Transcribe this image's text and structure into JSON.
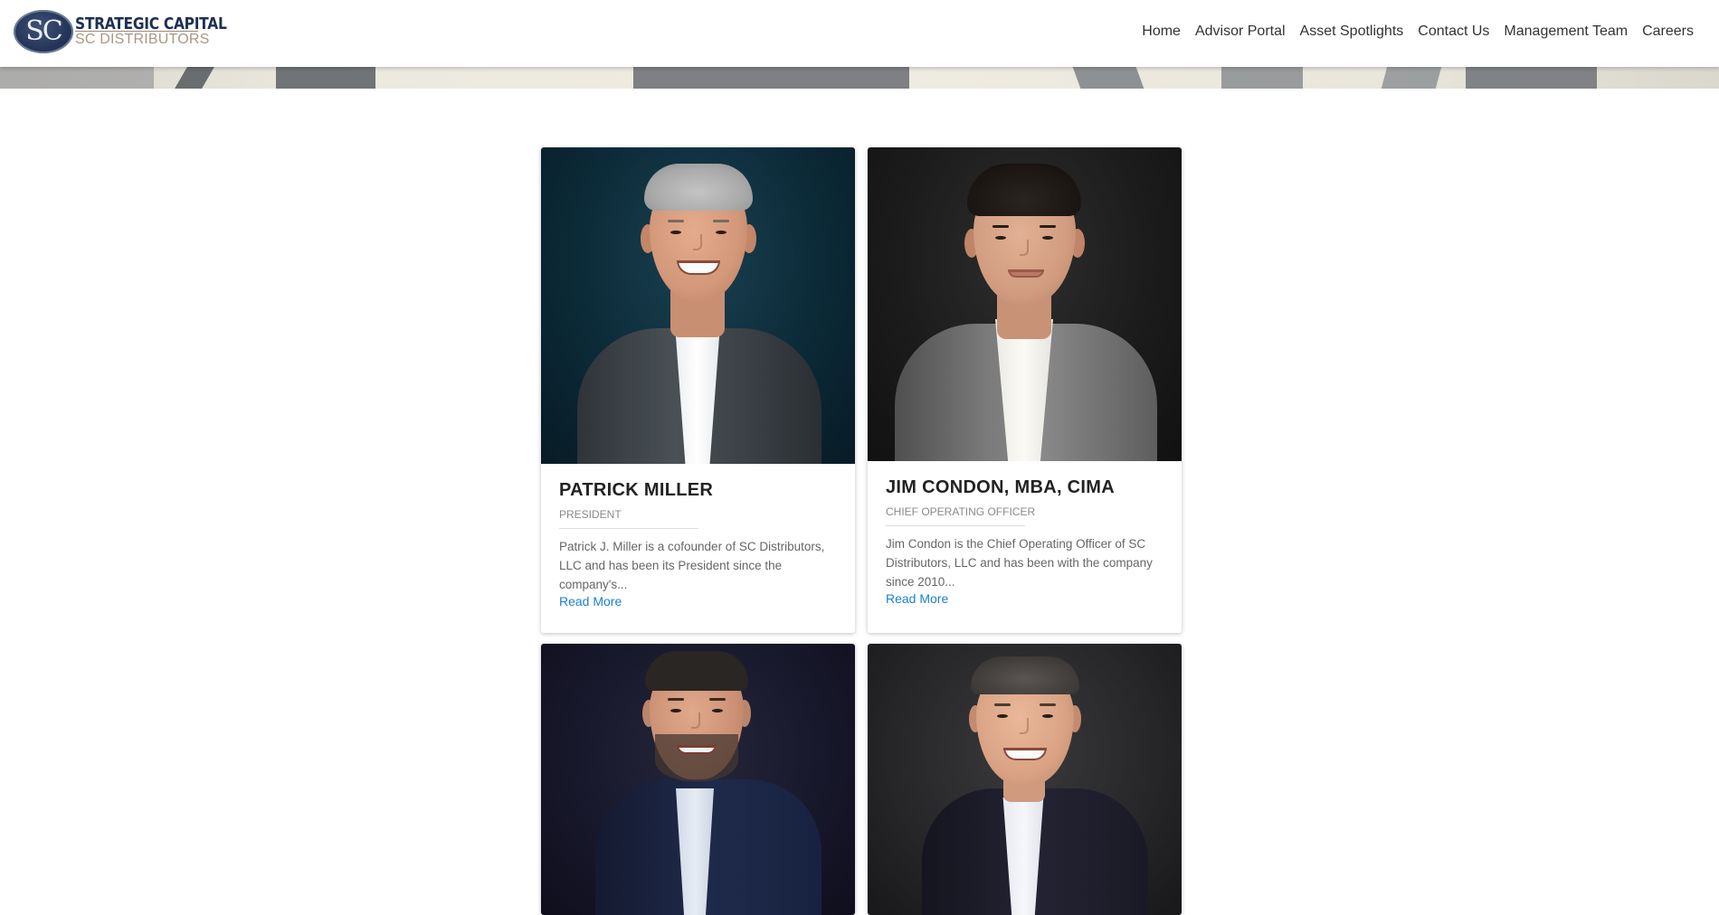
{
  "brand": {
    "mark": "SC",
    "name_line1": "STRATEGIC CAPITAL",
    "name_line2": "SC DISTRIBUTORS",
    "colors": {
      "navy": "#1e2f55",
      "tan": "#a99782"
    }
  },
  "nav": {
    "items": [
      {
        "label": "Home"
      },
      {
        "label": "Advisor Portal"
      },
      {
        "label": "Asset Spotlights"
      },
      {
        "label": "Contact Us"
      },
      {
        "label": "Management Team"
      },
      {
        "label": "Careers"
      }
    ]
  },
  "team": {
    "link_color": "#1a7fd1",
    "members": [
      {
        "name": "PATRICK MILLER",
        "title": "PRESIDENT",
        "desc": "Patrick J. Miller is a cofounder of SC Distributors, LLC and has been its President since the company's...",
        "link": "Read More",
        "photo_bg": "#0c2a38"
      },
      {
        "name": "JIM CONDON, MBA, CIMA",
        "title": "CHIEF OPERATING OFFICER",
        "desc": "Jim Condon is the Chief Operating Officer of SC Distributors, LLC and has been with the company since 2010...",
        "link": "Read More",
        "photo_bg": "#1c1c1c"
      },
      {
        "name": "",
        "title": "",
        "desc": "",
        "link": "",
        "photo_bg": "#17172a"
      },
      {
        "name": "",
        "title": "",
        "desc": "",
        "link": "",
        "photo_bg": "#262628"
      }
    ]
  }
}
